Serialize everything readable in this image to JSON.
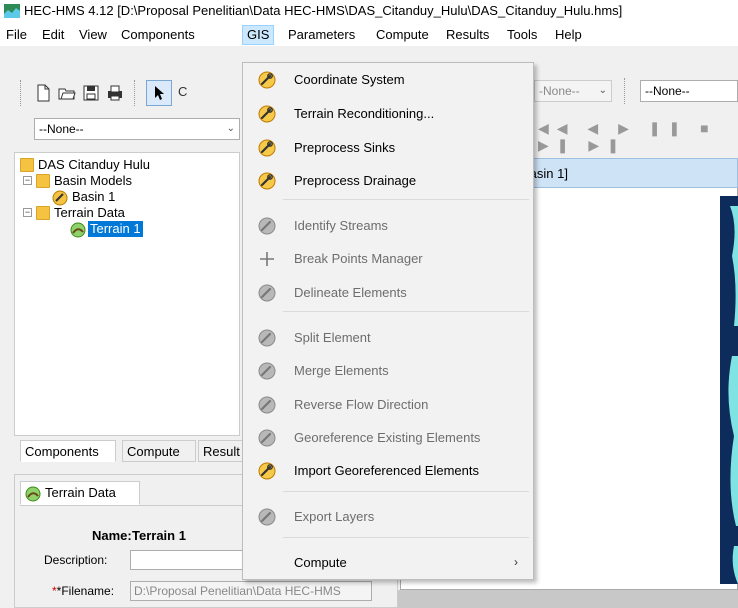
{
  "window": {
    "title": "HEC-HMS 4.12 [D:\\Proposal Penelitian\\Data HEC-HMS\\DAS_Citanduy_Hulu\\DAS_Citanduy_Hulu.hms]"
  },
  "menubar": {
    "items": [
      "File",
      "Edit",
      "View",
      "Components",
      "GIS",
      "Parameters",
      "Compute",
      "Results",
      "Tools",
      "Help"
    ],
    "active": "GIS"
  },
  "toolbar": {
    "combo_left": "--None--",
    "combo_mid": "-None--",
    "combo_right": "--None--"
  },
  "tree": {
    "root": "DAS Citanduy Hulu",
    "basin_models": "Basin Models",
    "basin_1": "Basin 1",
    "terrain_data": "Terrain Data",
    "terrain_1": "Terrain 1"
  },
  "left_tabs": [
    "Components",
    "Compute",
    "Result"
  ],
  "property_tab": "Terrain Data",
  "properties": {
    "name_label": "Name:",
    "name_value": "Terrain 1",
    "description_label": "Description:",
    "description_value": "",
    "filename_label": "*Filename:",
    "filename_value": "D:\\Proposal Penelitian\\Data HEC-HMS"
  },
  "basin_window": {
    "title": "Basin 1]"
  },
  "gis_menu": {
    "items": [
      {
        "label": "Coordinate System",
        "enabled": true,
        "icon": "wrench-icon"
      },
      {
        "label": "Terrain Reconditioning...",
        "enabled": true,
        "icon": "wrench-icon"
      },
      {
        "label": "Preprocess Sinks",
        "enabled": true,
        "icon": "wrench-icon"
      },
      {
        "label": "Preprocess Drainage",
        "enabled": true,
        "icon": "wrench-icon"
      },
      {
        "label": "Identify Streams",
        "enabled": false,
        "icon": "wrench-icon"
      },
      {
        "label": "Break Points Manager",
        "enabled": false,
        "icon": "crosshair-icon"
      },
      {
        "label": "Delineate Elements",
        "enabled": false,
        "icon": "wrench-icon"
      },
      {
        "label": "Split Element",
        "enabled": false,
        "icon": "wrench-icon"
      },
      {
        "label": "Merge Elements",
        "enabled": false,
        "icon": "wrench-icon"
      },
      {
        "label": "Reverse Flow Direction",
        "enabled": false,
        "icon": "wrench-icon"
      },
      {
        "label": "Georeference Existing Elements",
        "enabled": false,
        "icon": "wrench-icon"
      },
      {
        "label": "Import Georeferenced Elements",
        "enabled": true,
        "icon": "wrench-icon"
      },
      {
        "label": "Export Layers",
        "enabled": false,
        "icon": "wrench-icon"
      },
      {
        "label": "Compute",
        "enabled": true,
        "icon": "",
        "submenu": true
      }
    ]
  },
  "colors": {
    "menu_highlight": "#cce8ff",
    "selection": "#0078d7",
    "icon_enabled": "#e8a317",
    "icon_disabled": "#a0a0a0"
  }
}
